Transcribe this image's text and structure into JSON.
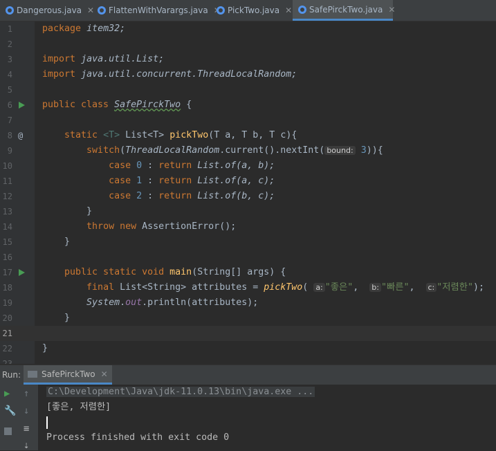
{
  "tabs": [
    {
      "label": "Dangerous.java",
      "active": false
    },
    {
      "label": "FlattenWithVarargs.java",
      "active": false
    },
    {
      "label": "PickTwo.java",
      "active": false
    },
    {
      "label": "SafePirckTwo.java",
      "active": true
    }
  ],
  "close_glyph": "✕",
  "editor": {
    "line_numbers": [
      "1",
      "2",
      "3",
      "4",
      "5",
      "6",
      "7",
      "8",
      "9",
      "10",
      "11",
      "12",
      "13",
      "14",
      "15",
      "16",
      "17",
      "18",
      "19",
      "20",
      "21",
      "22",
      "23"
    ],
    "current_line": "21",
    "code": {
      "l1_kw": "package",
      "l1_pkg": "item32;",
      "l3_kw": "import",
      "l3_path": "java.util.List;",
      "l4_kw": "import",
      "l4_path": "java.util.concurrent.ThreadLocalRandom;",
      "l6_kw": "public class",
      "l6_name": "SafePirckTwo",
      "l6_brace": " {",
      "l8_kw": "static",
      "l8_sig_a": "<T>",
      "l8_sig_b": "List<T>",
      "l8_fn": "pickTwo",
      "l8_params": "(T a, T b, T c){",
      "l9_kw": "switch",
      "l9_cls": "ThreadLocalRandom",
      "l9_call": ".current().nextInt(",
      "l9_hint": "bound:",
      "l9_num": "3",
      "l9_end": ")){",
      "l10_kw": "case",
      "l10_num": "0",
      "l10_rest": " : ",
      "l10_ret": "return",
      "l10_call": " List.of(a, b);",
      "l11_kw": "case",
      "l11_num": "1",
      "l11_rest": " : ",
      "l11_ret": "return",
      "l11_call": " List.of(a, c);",
      "l12_kw": "case",
      "l12_num": "2",
      "l12_rest": " : ",
      "l12_ret": "return",
      "l12_call": " List.of(b, c);",
      "l13": "}",
      "l14_kw": "throw new",
      "l14_rest": " AssertionError();",
      "l15": "}",
      "l17_kw": "public static void",
      "l17_fn": "main",
      "l17_rest": "(String[] args) {",
      "l18_kw": "final",
      "l18_type": "List<String>",
      "l18_var": " attributes = ",
      "l18_fn": "pickTwo",
      "l18_h1": "a:",
      "l18_s1": "\"좋은\"",
      "l18_h2": "b:",
      "l18_s2": "\"빠른\"",
      "l18_h3": "c:",
      "l18_s3": "\"저렴한\"",
      "l18_end": ");",
      "l19_sys": "System",
      "l19_out": "out",
      "l19_rest": ".println(attributes);",
      "l20": "}",
      "l22": "}"
    }
  },
  "run": {
    "label": "Run:",
    "tab_label": "SafePirckTwo",
    "console_lines": [
      "C:\\Development\\Java\\jdk-11.0.13\\bin\\java.exe ...",
      "[좋은, 저렴한]",
      "",
      "Process finished with exit code 0"
    ]
  },
  "gutter_icons": [
    "run-icon",
    "override-icon",
    "run-icon"
  ]
}
